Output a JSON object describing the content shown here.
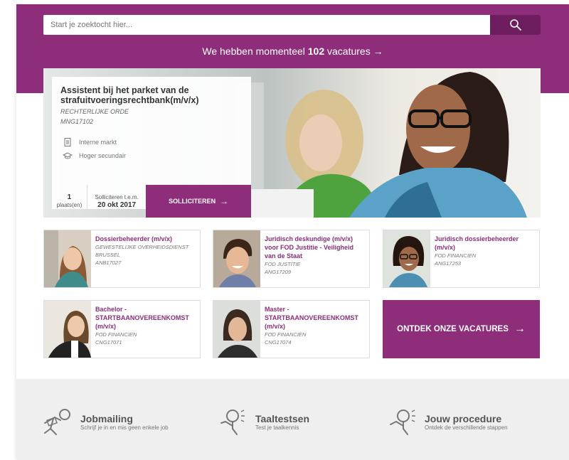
{
  "search": {
    "placeholder": "Start je zoektocht hier...",
    "button_icon": "search-icon"
  },
  "vacancies_banner": {
    "prefix": "We hebben momenteel",
    "count": "102",
    "suffix": "vacatures",
    "arrow": "→"
  },
  "featured": {
    "title": "Assistent bij het parket van de strafuitvoeringsrechtbank(m/v/x)",
    "org": "RECHTERLIJKE ORDE",
    "ref": "MNG17102",
    "market": "Interne markt",
    "education": "Hoger secundair",
    "places_count": "1",
    "places_label": "plaats(en)",
    "apply_until_label": "Solliciteren t.e.m.",
    "apply_until_date": "20 okt 2017",
    "apply_button": "SOLLICITEREN",
    "arrow": "→"
  },
  "jobs": [
    {
      "title": "Dossierbeheerder (m/v/x)",
      "org": "GEWESTELIJKE OVERHEIDSDIENST",
      "location": "BRUSSEL",
      "ref": "ANB17027"
    },
    {
      "title": "Juridisch deskundige (m/v/x) voor FOD Justitie - Veiligheid van de Staat",
      "org": "FOD JUSTITIE",
      "location": "",
      "ref": "ANG17209"
    },
    {
      "title": "Juridisch dossierbeheerder (m/v/x)",
      "org": "FOD FINANCIEN",
      "location": "",
      "ref": "ANG17253"
    },
    {
      "title": "Bachelor - STARTBAANOVEREENKOMST (m/v/x)",
      "org": "FOD FINANCIEN",
      "location": "",
      "ref": "CNG17071"
    },
    {
      "title": "Master - STARTBAANOVEREENKOMST (m/v/x)",
      "org": "FOD FINANCIEN",
      "location": "",
      "ref": "CNG17074"
    }
  ],
  "discover_button": "ONTDEK ONZE VACATURES",
  "footer": [
    {
      "title": "Jobmailing",
      "subtitle": "Schrijf je in en mis geen enkele job",
      "icon": "jobmailing-icon"
    },
    {
      "title": "Taaltestsen",
      "subtitle": "Test je taalkennis",
      "icon": "language-test-icon"
    },
    {
      "title": "Jouw procedure",
      "subtitle": "Ontdek de verschillende stappen",
      "icon": "procedure-icon"
    }
  ],
  "colors": {
    "brand": "#8e2d7a",
    "brand_dark": "#6e1e5f",
    "footer_bg": "#efefef"
  }
}
